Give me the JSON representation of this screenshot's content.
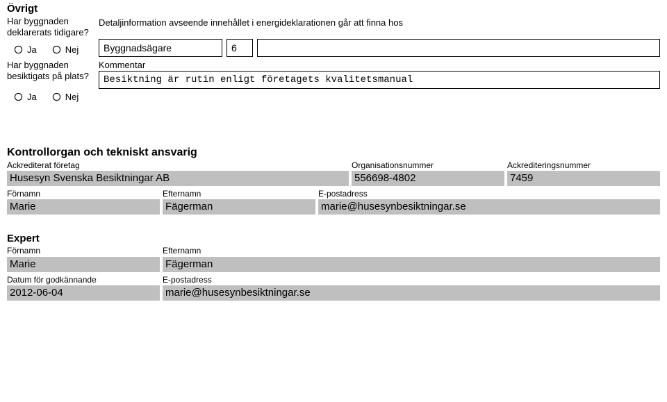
{
  "ovrigt": {
    "heading": "Övrigt",
    "q1_line": "Har byggnaden deklarerats tidigare?",
    "q2_line": "Har byggnaden besiktigats på plats?",
    "ja": "Ja",
    "nej": "Nej",
    "intro": "Detaljinformation avseende innehållet i energideklarationen går att finna hos",
    "owner_label": "Byggnadsägare",
    "owner_num": "6",
    "owner_extra": "",
    "kommentar_label": "Kommentar",
    "kommentar_value": "Besiktning är rutin enligt företagets kvalitetsmanual"
  },
  "kontroll": {
    "heading": "Kontrollorgan och tekniskt ansvarig",
    "foretag_label": "Ackrediterat företag",
    "foretag_value": "Husesyn Svenska Besiktningar AB",
    "orgnr_label": "Organisationsnummer",
    "orgnr_value": "556698-4802",
    "acknr_label": "Ackrediteringsnummer",
    "acknr_value": "7459",
    "fornamn_label": "Förnamn",
    "fornamn_value": "Marie",
    "efternamn_label": "Efternamn",
    "efternamn_value": "Fägerman",
    "epost_label": "E-postadress",
    "epost_value": "marie@husesynbesiktningar.se"
  },
  "expert": {
    "heading": "Expert",
    "fornamn_label": "Förnamn",
    "fornamn_value": "Marie",
    "efternamn_label": "Efternamn",
    "efternamn_value": "Fägerman",
    "datum_label": "Datum för godkännande",
    "datum_value": "2012-06-04",
    "epost_label": "E-postadress",
    "epost_value": "marie@husesynbesiktningar.se"
  }
}
